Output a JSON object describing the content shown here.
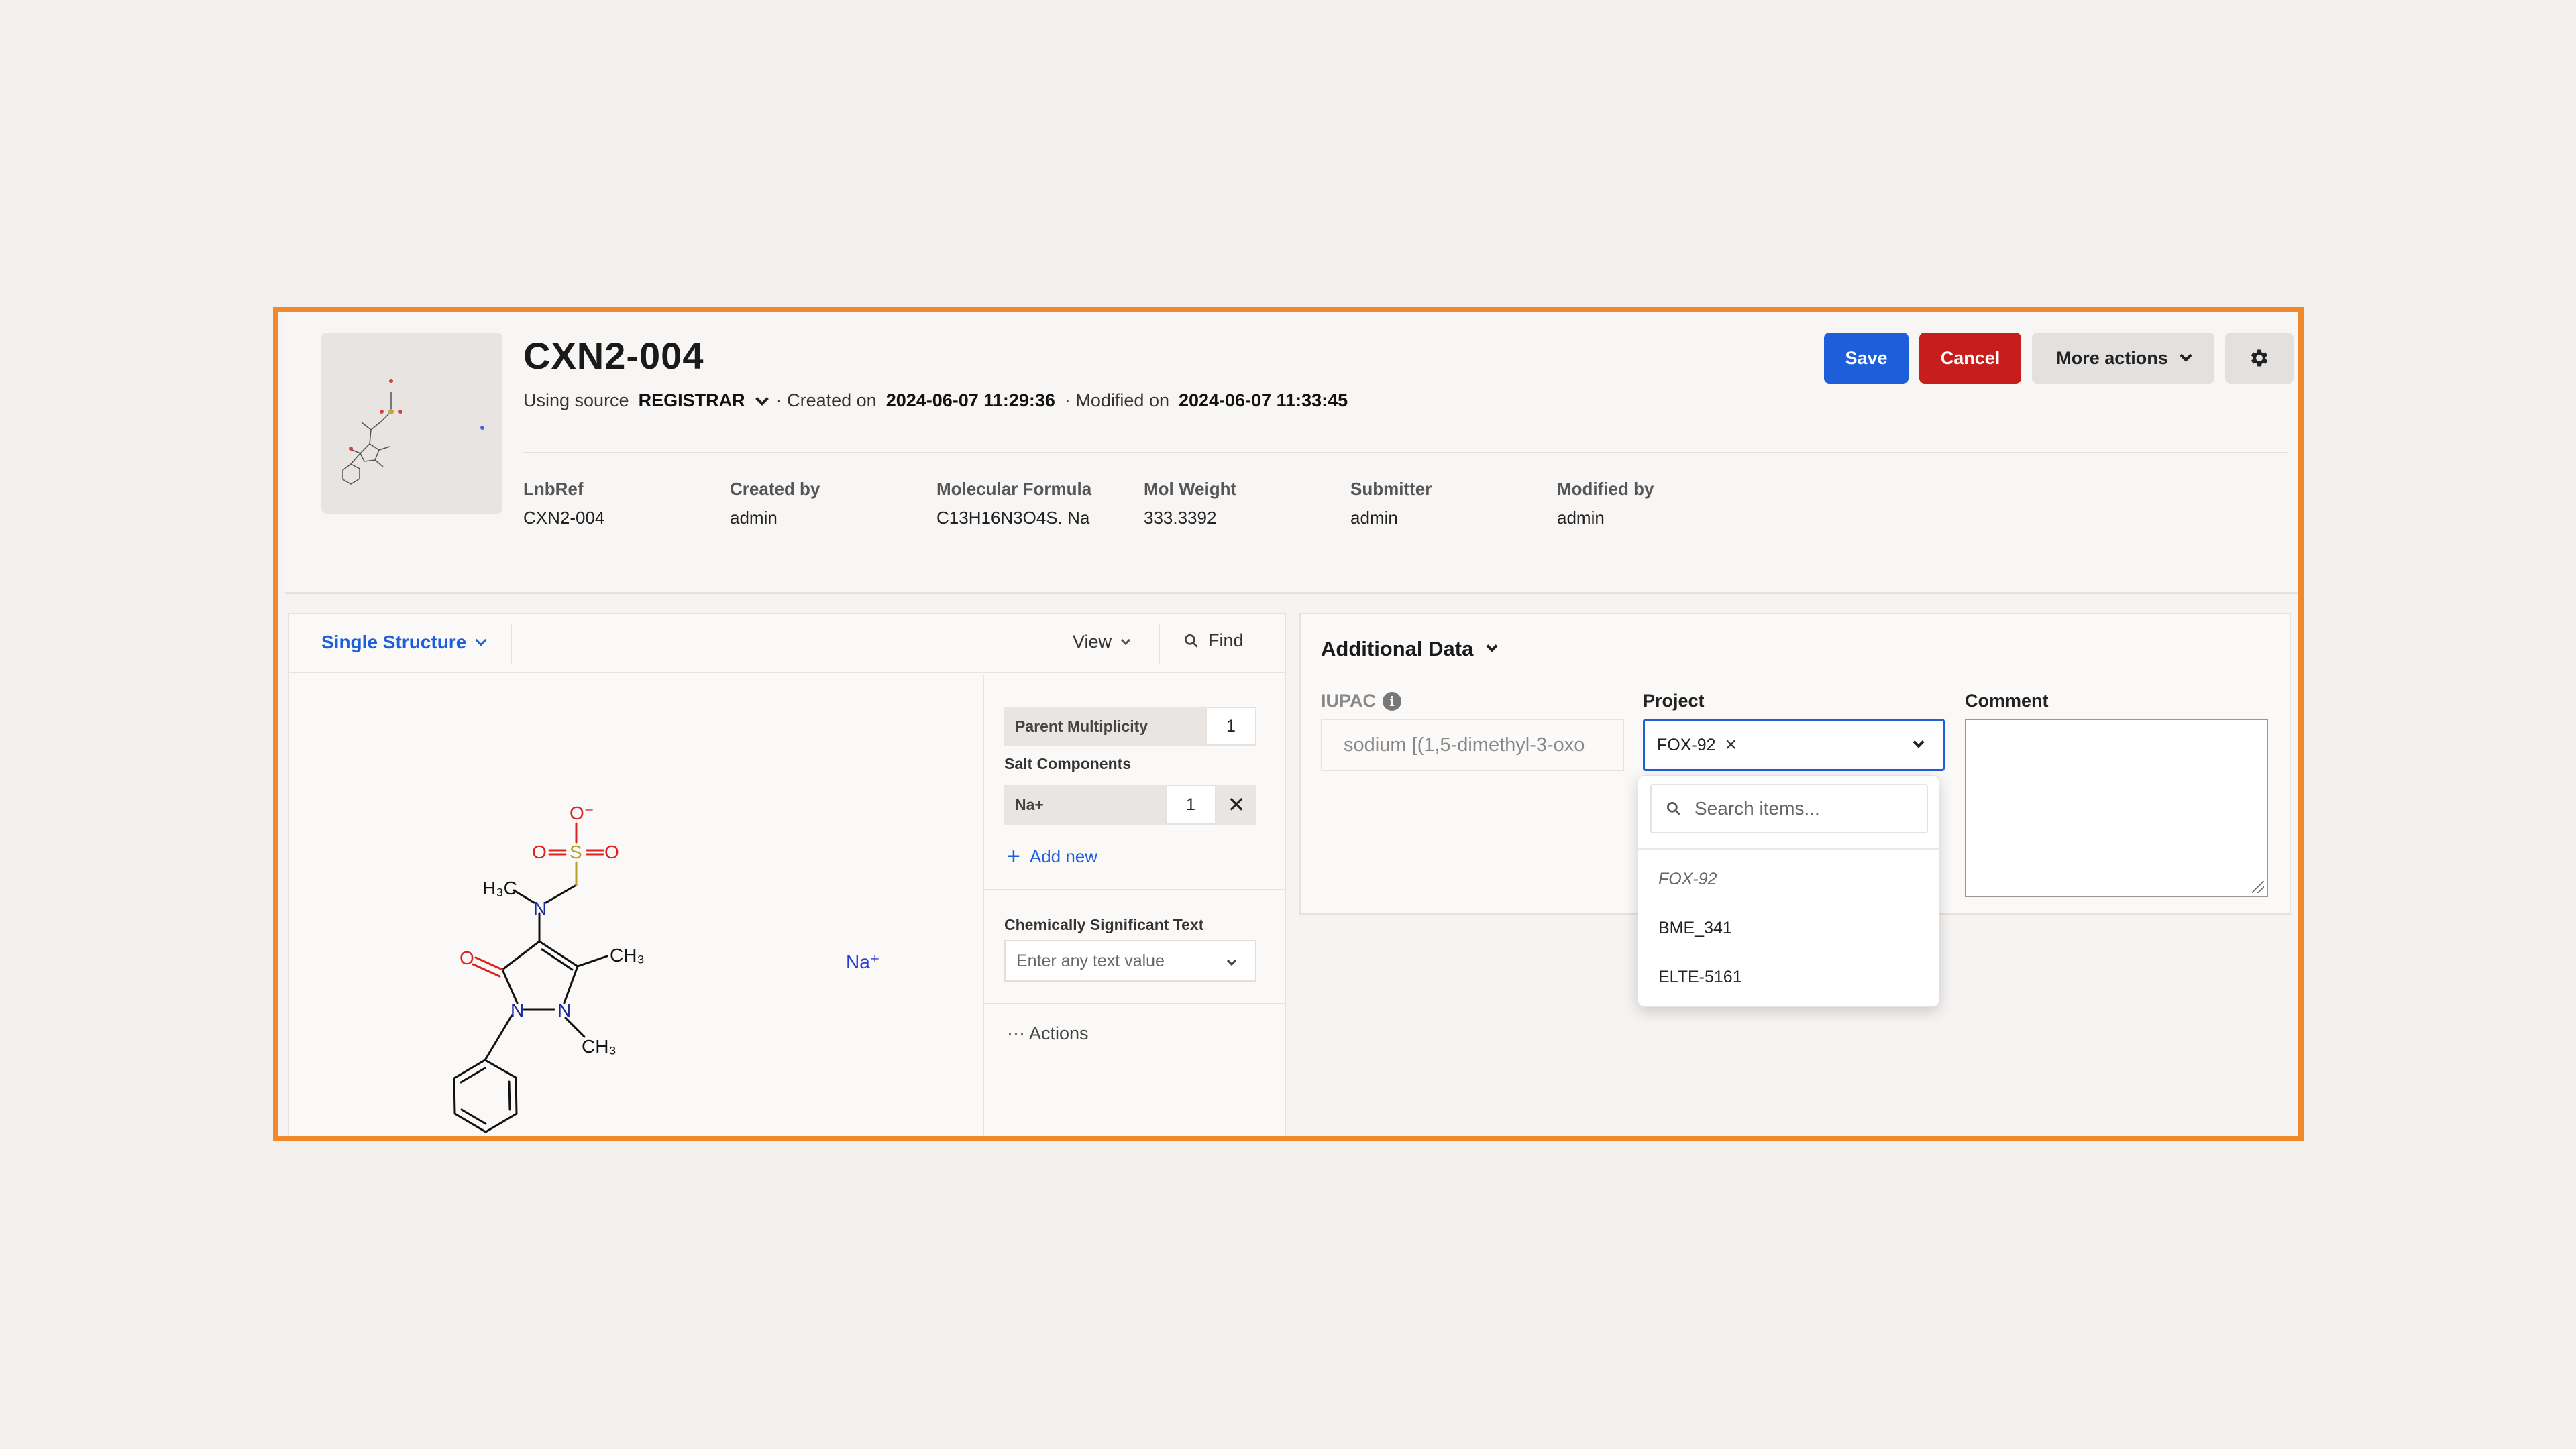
{
  "record": {
    "title": "CXN2-004",
    "using_source_label": "Using source",
    "source_value": "REGISTRAR",
    "created_label": "· Created on",
    "created_value": "2024-06-07 11:29:36",
    "modified_label": "· Modified on",
    "modified_value": "2024-06-07 11:33:45"
  },
  "toolbar": {
    "save_label": "Save",
    "cancel_label": "Cancel",
    "more_actions_label": "More actions",
    "settings_icon": "gear-icon"
  },
  "meta": [
    {
      "label": "LnbRef",
      "value": "CXN2-004"
    },
    {
      "label": "Created by",
      "value": "admin"
    },
    {
      "label": "Molecular Formula",
      "value": "C13H16N3O4S. Na"
    },
    {
      "label": "Mol Weight",
      "value": "333.3392"
    },
    {
      "label": "Submitter",
      "value": "admin"
    },
    {
      "label": "Modified by",
      "value": "admin"
    }
  ],
  "structure_panel": {
    "mode_label": "Single Structure",
    "view_label": "View",
    "find_label": "Find",
    "parent_multiplicity_label": "Parent Multiplicity",
    "parent_multiplicity_value": "1",
    "salt_components_label": "Salt Components",
    "salt_name": "Na+",
    "salt_count": "1",
    "add_new_label": "Add new",
    "cst_label": "Chemically Significant Text",
    "cst_placeholder": "Enter any text value",
    "actions_label": "··· Actions"
  },
  "molecule_labels": {
    "o_minus": "O⁻",
    "o_left": "O",
    "s": "S",
    "o_right": "O",
    "h3c": "H₃C",
    "n_amine": "N",
    "o_keto": "O",
    "ch3_top": "CH₃",
    "n1": "N",
    "n2": "N",
    "ch3_bottom": "CH₃",
    "na": "Na⁺"
  },
  "additional_data": {
    "title": "Additional Data",
    "iupac_label": "IUPAC",
    "iupac_value": "sodium [(1,5-dimethyl-3-oxo",
    "project_label": "Project",
    "project_tag": "FOX-92",
    "comment_label": "Comment"
  },
  "project_dropdown": {
    "search_placeholder": "Search items...",
    "items": [
      "FOX-92",
      "BME_341",
      "ELTE-5161"
    ]
  },
  "colors": {
    "accent": "#1d5fdb",
    "danger": "#c81d1d",
    "frame": "#f0882c"
  }
}
